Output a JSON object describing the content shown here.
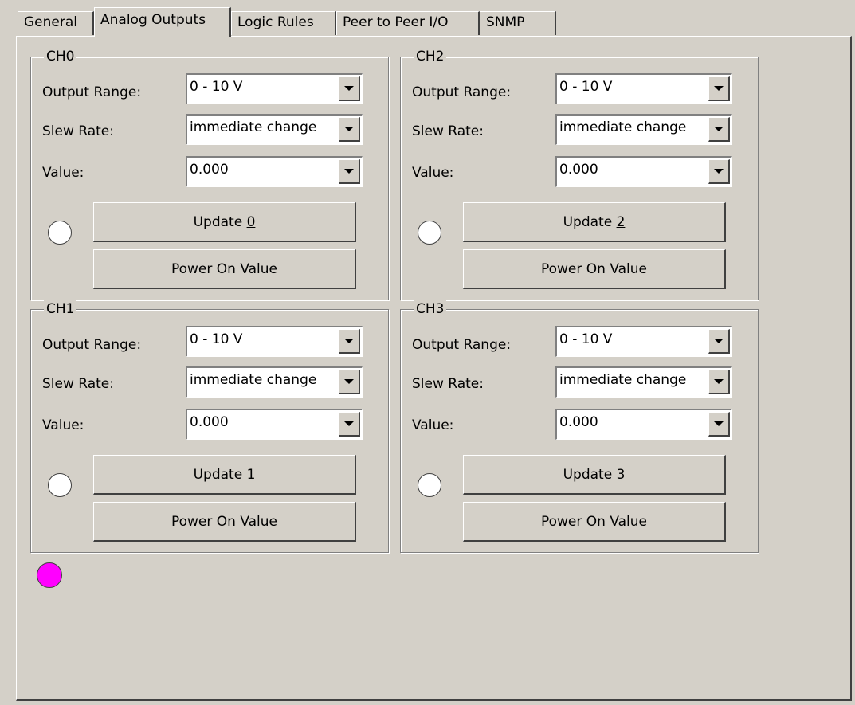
{
  "tabs": [
    {
      "label": "General"
    },
    {
      "label": "Analog Outputs"
    },
    {
      "label": "Logic Rules"
    },
    {
      "label": "Peer to Peer I/O"
    },
    {
      "label": "SNMP"
    }
  ],
  "active_tab": "Analog Outputs",
  "labels": {
    "output_range": "Output Range:",
    "slew_rate": "Slew Rate:",
    "value": "Value:",
    "power_on": "Power On Value"
  },
  "channels": [
    {
      "title": "CH0",
      "output_range": "0 - 10 V",
      "slew_rate": "immediate change",
      "value": "0.000",
      "update_prefix": "Update ",
      "update_key": "0"
    },
    {
      "title": "CH2",
      "output_range": "0 - 10 V",
      "slew_rate": "immediate change",
      "value": "0.000",
      "update_prefix": "Update ",
      "update_key": "2"
    },
    {
      "title": "CH1",
      "output_range": "0 - 10 V",
      "slew_rate": "immediate change",
      "value": "0.000",
      "update_prefix": "Update ",
      "update_key": "1"
    },
    {
      "title": "CH3",
      "output_range": "0 - 10 V",
      "slew_rate": "immediate change",
      "value": "0.000",
      "update_prefix": "Update ",
      "update_key": "3"
    }
  ],
  "colors": {
    "status_led": "#ff00ff",
    "channel_led": "#ffffff",
    "face": "#d4d0c8"
  }
}
